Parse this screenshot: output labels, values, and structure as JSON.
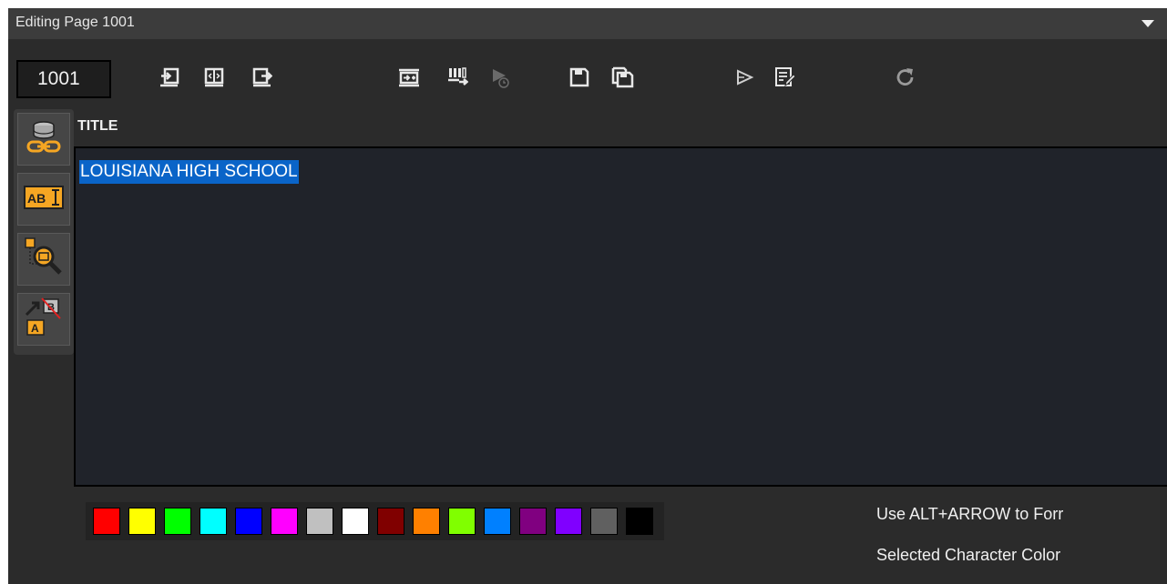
{
  "window": {
    "title": "Editing Page 1001"
  },
  "page_number": "1001",
  "toolbar": {
    "icons": [
      "import-icon",
      "split-icon",
      "export-icon",
      "insert-page-icon",
      "page-list-icon",
      "scheduled-play-icon",
      "save-icon",
      "save-all-icon",
      "play-icon",
      "edit-notes-icon",
      "refresh-icon"
    ]
  },
  "side_tools": [
    {
      "icon": "database-link-icon"
    },
    {
      "icon": "text-field-icon"
    },
    {
      "icon": "find-field-icon"
    },
    {
      "icon": "text-replace-icon"
    }
  ],
  "field": {
    "label": "TITLE",
    "value": "LOUISIANA HIGH SCHOOL",
    "selection_color": "#0a64c8"
  },
  "palette": {
    "colors": [
      "#ff0000",
      "#ffff00",
      "#00ff00",
      "#00ffff",
      "#0000ff",
      "#ff00ff",
      "#c0c0c0",
      "#ffffff",
      "#800000",
      "#ff8000",
      "#80ff00",
      "#0080ff",
      "#800080",
      "#8000ff",
      "#606060",
      "#000000"
    ]
  },
  "hints": {
    "line1": "Use ALT+ARROW to Forr",
    "line2": "Selected Character Color"
  }
}
